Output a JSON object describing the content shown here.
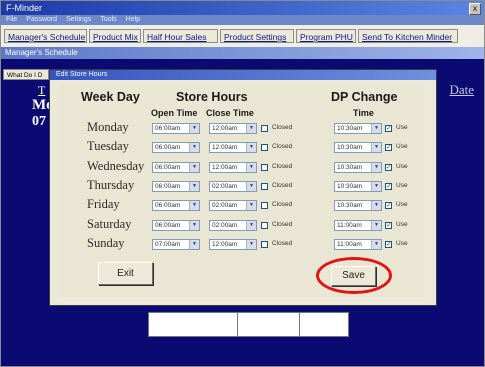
{
  "window": {
    "title": "F-Minder",
    "close_glyph": "x"
  },
  "menubar": {
    "items": [
      "File",
      "Password",
      "Settings",
      "Tools",
      "Help"
    ]
  },
  "tabs": [
    "Manager's Schedule",
    "Product Mix",
    "Half Hour Sales",
    "Product Settings",
    "Program PHU",
    "Send To Kitchen Minder"
  ],
  "schedule_bar": {
    "title": "Manager's Schedule"
  },
  "background": {
    "tab_label": "What Do I D",
    "partial_t": "T",
    "partial_mo": "Mo",
    "partial_date": "07",
    "date_link": "Date"
  },
  "dialog": {
    "title": "Edit Store Hours",
    "headers": {
      "week_day": "Week Day",
      "store_hours": "Store Hours",
      "dp_change": "DP Change",
      "open_time": "Open Time",
      "close_time": "Close Time",
      "time": "Time"
    },
    "closed_label": "Closed",
    "use_label": "Use",
    "rows": [
      {
        "day": "Monday",
        "open": "06:00am",
        "close": "12:00am",
        "closed": false,
        "dp_time": "10:30am",
        "use": true
      },
      {
        "day": "Tuesday",
        "open": "06:00am",
        "close": "12:00am",
        "closed": false,
        "dp_time": "10:30am",
        "use": true
      },
      {
        "day": "Wednesday",
        "open": "06:00am",
        "close": "12:00am",
        "closed": false,
        "dp_time": "10:30am",
        "use": true
      },
      {
        "day": "Thursday",
        "open": "06:00am",
        "close": "02:00am",
        "closed": false,
        "dp_time": "10:30am",
        "use": true
      },
      {
        "day": "Friday",
        "open": "06:00am",
        "close": "02:00am",
        "closed": false,
        "dp_time": "10:30am",
        "use": true
      },
      {
        "day": "Saturday",
        "open": "06:00am",
        "close": "02:00am",
        "closed": false,
        "dp_time": "11:00am",
        "use": true
      },
      {
        "day": "Sunday",
        "open": "07:00am",
        "close": "12:00am",
        "closed": false,
        "dp_time": "11:00am",
        "use": true
      }
    ],
    "exit_label": "Exit",
    "save_label": "Save"
  },
  "colors": {
    "desktop_blue": "#0a0a72",
    "dialog_bg": "#ece9d8",
    "highlight_red": "#e01414",
    "titlebar_blue": "#1c3aa8"
  },
  "icons": {
    "dropdown": "chevron-down-icon",
    "close": "close-icon",
    "check": "check-icon"
  }
}
